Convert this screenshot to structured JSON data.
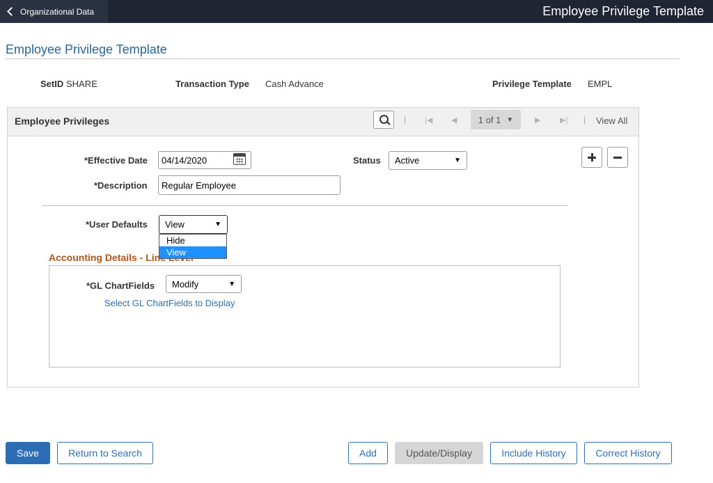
{
  "topbar": {
    "back_label": "Organizational Data",
    "title": "Employee Privilege Template"
  },
  "page": {
    "title": "Employee Privilege Template"
  },
  "keys": {
    "setid_label": "SetID",
    "setid_value": "SHARE",
    "transaction_type_label": "Transaction Type",
    "transaction_type_value": "Cash Advance",
    "privilege_template_label": "Privilege Template",
    "privilege_template_value": "EMPL"
  },
  "group": {
    "title": "Employee Privileges",
    "nav": {
      "count": "1 of 1",
      "view_all": "View All"
    }
  },
  "form": {
    "effective_date_label": "*Effective Date",
    "effective_date_value": "04/14/2020",
    "status_label": "Status",
    "status_value": "Active",
    "description_label": "*Description",
    "description_value": "Regular Employee",
    "user_defaults_label": "*User Defaults",
    "user_defaults_value": "View",
    "user_defaults_options": [
      "Hide",
      "View"
    ]
  },
  "accounting": {
    "title": "Accounting Details - Line Level",
    "gl_label": "*GL ChartFields",
    "gl_value": "Modify",
    "gl_link": "Select GL ChartFields to Display"
  },
  "footer": {
    "save": "Save",
    "return_to_search": "Return to Search",
    "add": "Add",
    "update_display": "Update/Display",
    "include_history": "Include History",
    "correct_history": "Correct History"
  },
  "colors": {
    "topbar": "#1f2532",
    "accent": "#2d6db5",
    "section_title": "#b0561a",
    "dropdown_selected": "#1e90ff"
  },
  "icons": [
    "chevron-left-icon",
    "search-icon",
    "first-icon",
    "prev-icon",
    "next-icon",
    "last-icon",
    "calendar-icon",
    "plus-icon",
    "minus-icon"
  ]
}
